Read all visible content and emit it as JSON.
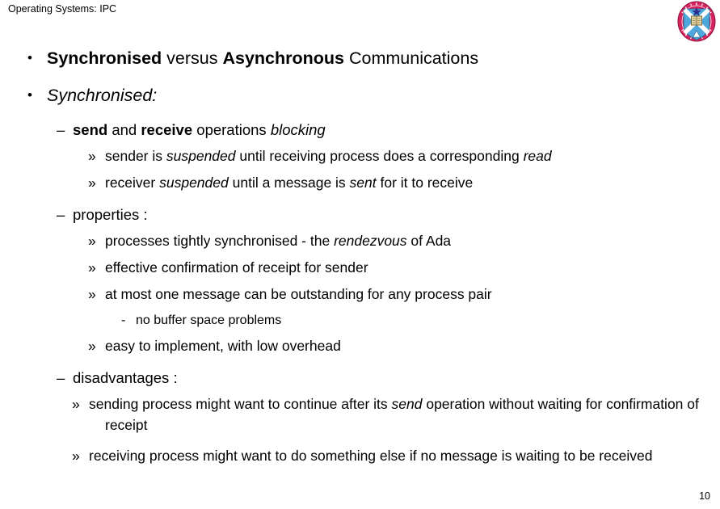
{
  "header": {
    "title": "Operating Systems: IPC",
    "crest_name": "university-of-edinburgh-crest",
    "crest_colors": {
      "ring": "#d6245f",
      "ring_outline": "#8e0f3a",
      "shield": "#4fa8dc",
      "saltire": "#ffffff",
      "book": "#e8d9a8",
      "book_outline": "#6b5a2a",
      "star": "#2a2a8c"
    }
  },
  "bullets": {
    "b1": {
      "marker": "•",
      "parts": [
        {
          "text": "Synchronised",
          "style": "bold"
        },
        {
          "text": " versus ",
          "style": "normal"
        },
        {
          "text": "Asynchronous",
          "style": "bold"
        },
        {
          "text": " Communications",
          "style": "normal"
        }
      ]
    },
    "b2": {
      "marker": "•",
      "parts": [
        {
          "text": "Synchronised:",
          "style": "italic"
        }
      ]
    },
    "b3": {
      "marker": "–",
      "parts": [
        {
          "text": "send",
          "style": "bold"
        },
        {
          "text": " and ",
          "style": "normal"
        },
        {
          "text": "receive",
          "style": "bold"
        },
        {
          "text": " operations ",
          "style": "normal"
        },
        {
          "text": "blocking",
          "style": "italic"
        }
      ]
    },
    "b4": {
      "marker": "»",
      "parts": [
        {
          "text": "sender is ",
          "style": "normal"
        },
        {
          "text": "suspended",
          "style": "italic"
        },
        {
          "text": " until receiving process does a corresponding ",
          "style": "normal"
        },
        {
          "text": "read",
          "style": "italic"
        }
      ]
    },
    "b5": {
      "marker": "»",
      "parts": [
        {
          "text": "receiver ",
          "style": "normal"
        },
        {
          "text": "suspended",
          "style": "italic"
        },
        {
          "text": " until a message is ",
          "style": "normal"
        },
        {
          "text": "sent",
          "style": "italic"
        },
        {
          "text": " for it to receive",
          "style": "normal"
        }
      ]
    },
    "b6": {
      "marker": "–",
      "parts": [
        {
          "text": "properties :",
          "style": "normal"
        }
      ]
    },
    "b7": {
      "marker": "»",
      "parts": [
        {
          "text": "processes tightly synchronised - the ",
          "style": "normal"
        },
        {
          "text": "rendezvous",
          "style": "italic"
        },
        {
          "text": " of Ada",
          "style": "normal"
        }
      ]
    },
    "b8": {
      "marker": "»",
      "parts": [
        {
          "text": "effective confirmation of receipt for sender",
          "style": "normal"
        }
      ]
    },
    "b9": {
      "marker": "»",
      "parts": [
        {
          "text": "at most one message can be outstanding for any process pair",
          "style": "normal"
        }
      ]
    },
    "b10": {
      "marker": "-",
      "parts": [
        {
          "text": "no buffer space problems",
          "style": "normal"
        }
      ]
    },
    "b11": {
      "marker": "»",
      "parts": [
        {
          "text": "easy to implement, with low overhead",
          "style": "normal"
        }
      ]
    },
    "b12": {
      "marker": "–",
      "parts": [
        {
          "text": "disadvantages :",
          "style": "normal"
        }
      ]
    },
    "b13": {
      "marker": "»",
      "parts": [
        {
          "text": "sending process might want to continue after its ",
          "style": "normal"
        },
        {
          "text": "send",
          "style": "italic"
        },
        {
          "text": " operation without waiting for confirmation of receipt",
          "style": "normal"
        }
      ]
    },
    "b14": {
      "marker": "»",
      "parts": [
        {
          "text": "receiving process might want to do something else if no message is waiting to be received",
          "style": "normal"
        }
      ]
    }
  },
  "footer": {
    "page_number": "10"
  }
}
